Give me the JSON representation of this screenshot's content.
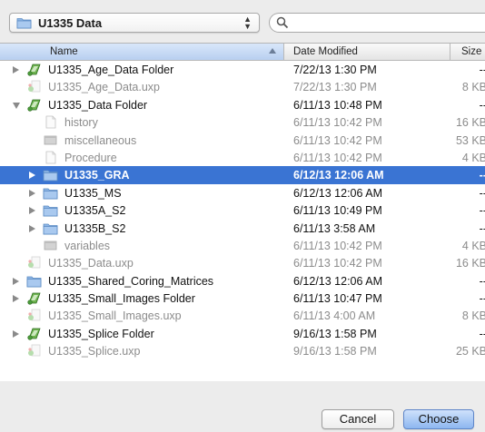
{
  "toolbar": {
    "folder_popup_label": "U1335 Data",
    "search_value": "",
    "search_placeholder": ""
  },
  "columns": {
    "name": "Name",
    "date": "Date Modified",
    "size": "Size"
  },
  "rows": [
    {
      "name": "U1335_Age_Data Folder",
      "date": "7/22/13 1:30 PM",
      "size": "--",
      "indent": 0,
      "disclosure": "closed",
      "icon": "package-folder-icon",
      "dim": false,
      "selected": false
    },
    {
      "name": "U1335_Age_Data.uxp",
      "date": "7/22/13 1:30 PM",
      "size": "8 KB",
      "indent": 0,
      "disclosure": "none",
      "icon": "uxp-file-icon",
      "dim": true,
      "selected": false
    },
    {
      "name": "U1335_Data Folder",
      "date": "6/11/13 10:48 PM",
      "size": "--",
      "indent": 0,
      "disclosure": "open",
      "icon": "package-folder-icon",
      "dim": false,
      "selected": false
    },
    {
      "name": "history",
      "date": "6/11/13 10:42 PM",
      "size": "16 KB",
      "indent": 1,
      "disclosure": "none",
      "icon": "document-icon",
      "dim": true,
      "selected": false
    },
    {
      "name": "miscellaneous",
      "date": "6/11/13 10:42 PM",
      "size": "53 KB",
      "indent": 1,
      "disclosure": "none",
      "icon": "data-file-icon",
      "dim": true,
      "selected": false
    },
    {
      "name": "Procedure",
      "date": "6/11/13 10:42 PM",
      "size": "4 KB",
      "indent": 1,
      "disclosure": "none",
      "icon": "document-icon",
      "dim": true,
      "selected": false
    },
    {
      "name": "U1335_GRA",
      "date": "6/12/13 12:06 AM",
      "size": "--",
      "indent": 1,
      "disclosure": "closed",
      "icon": "folder-icon",
      "dim": false,
      "selected": true
    },
    {
      "name": "U1335_MS",
      "date": "6/12/13 12:06 AM",
      "size": "--",
      "indent": 1,
      "disclosure": "closed",
      "icon": "folder-icon",
      "dim": false,
      "selected": false
    },
    {
      "name": "U1335A_S2",
      "date": "6/11/13 10:49 PM",
      "size": "--",
      "indent": 1,
      "disclosure": "closed",
      "icon": "folder-icon",
      "dim": false,
      "selected": false
    },
    {
      "name": "U1335B_S2",
      "date": "6/11/13 3:58 AM",
      "size": "--",
      "indent": 1,
      "disclosure": "closed",
      "icon": "folder-icon",
      "dim": false,
      "selected": false
    },
    {
      "name": "variables",
      "date": "6/11/13 10:42 PM",
      "size": "4 KB",
      "indent": 1,
      "disclosure": "none",
      "icon": "data-file-icon",
      "dim": true,
      "selected": false
    },
    {
      "name": "U1335_Data.uxp",
      "date": "6/11/13 10:42 PM",
      "size": "16 KB",
      "indent": 0,
      "disclosure": "none",
      "icon": "uxp-file-icon",
      "dim": true,
      "selected": false
    },
    {
      "name": "U1335_Shared_Coring_Matrices",
      "date": "6/12/13 12:06 AM",
      "size": "--",
      "indent": 0,
      "disclosure": "closed",
      "icon": "folder-icon",
      "dim": false,
      "selected": false
    },
    {
      "name": "U1335_Small_Images Folder",
      "date": "6/11/13 10:47 PM",
      "size": "--",
      "indent": 0,
      "disclosure": "closed",
      "icon": "package-folder-icon",
      "dim": false,
      "selected": false
    },
    {
      "name": "U1335_Small_Images.uxp",
      "date": "6/11/13 4:00 AM",
      "size": "8 KB",
      "indent": 0,
      "disclosure": "none",
      "icon": "uxp-file-icon",
      "dim": true,
      "selected": false
    },
    {
      "name": "U1335_Splice Folder",
      "date": "9/16/13 1:58 PM",
      "size": "--",
      "indent": 0,
      "disclosure": "closed",
      "icon": "package-folder-icon",
      "dim": false,
      "selected": false
    },
    {
      "name": "U1335_Splice.uxp",
      "date": "9/16/13 1:58 PM",
      "size": "25 KB",
      "indent": 0,
      "disclosure": "none",
      "icon": "uxp-file-icon",
      "dim": true,
      "selected": false
    }
  ],
  "buttons": {
    "cancel": "Cancel",
    "choose": "Choose"
  },
  "colors": {
    "selection": "#3a74d3",
    "folder_blue": "#8fb7e6",
    "package_green": "#4a9a3a",
    "dim_text": "#8c8c8c"
  }
}
